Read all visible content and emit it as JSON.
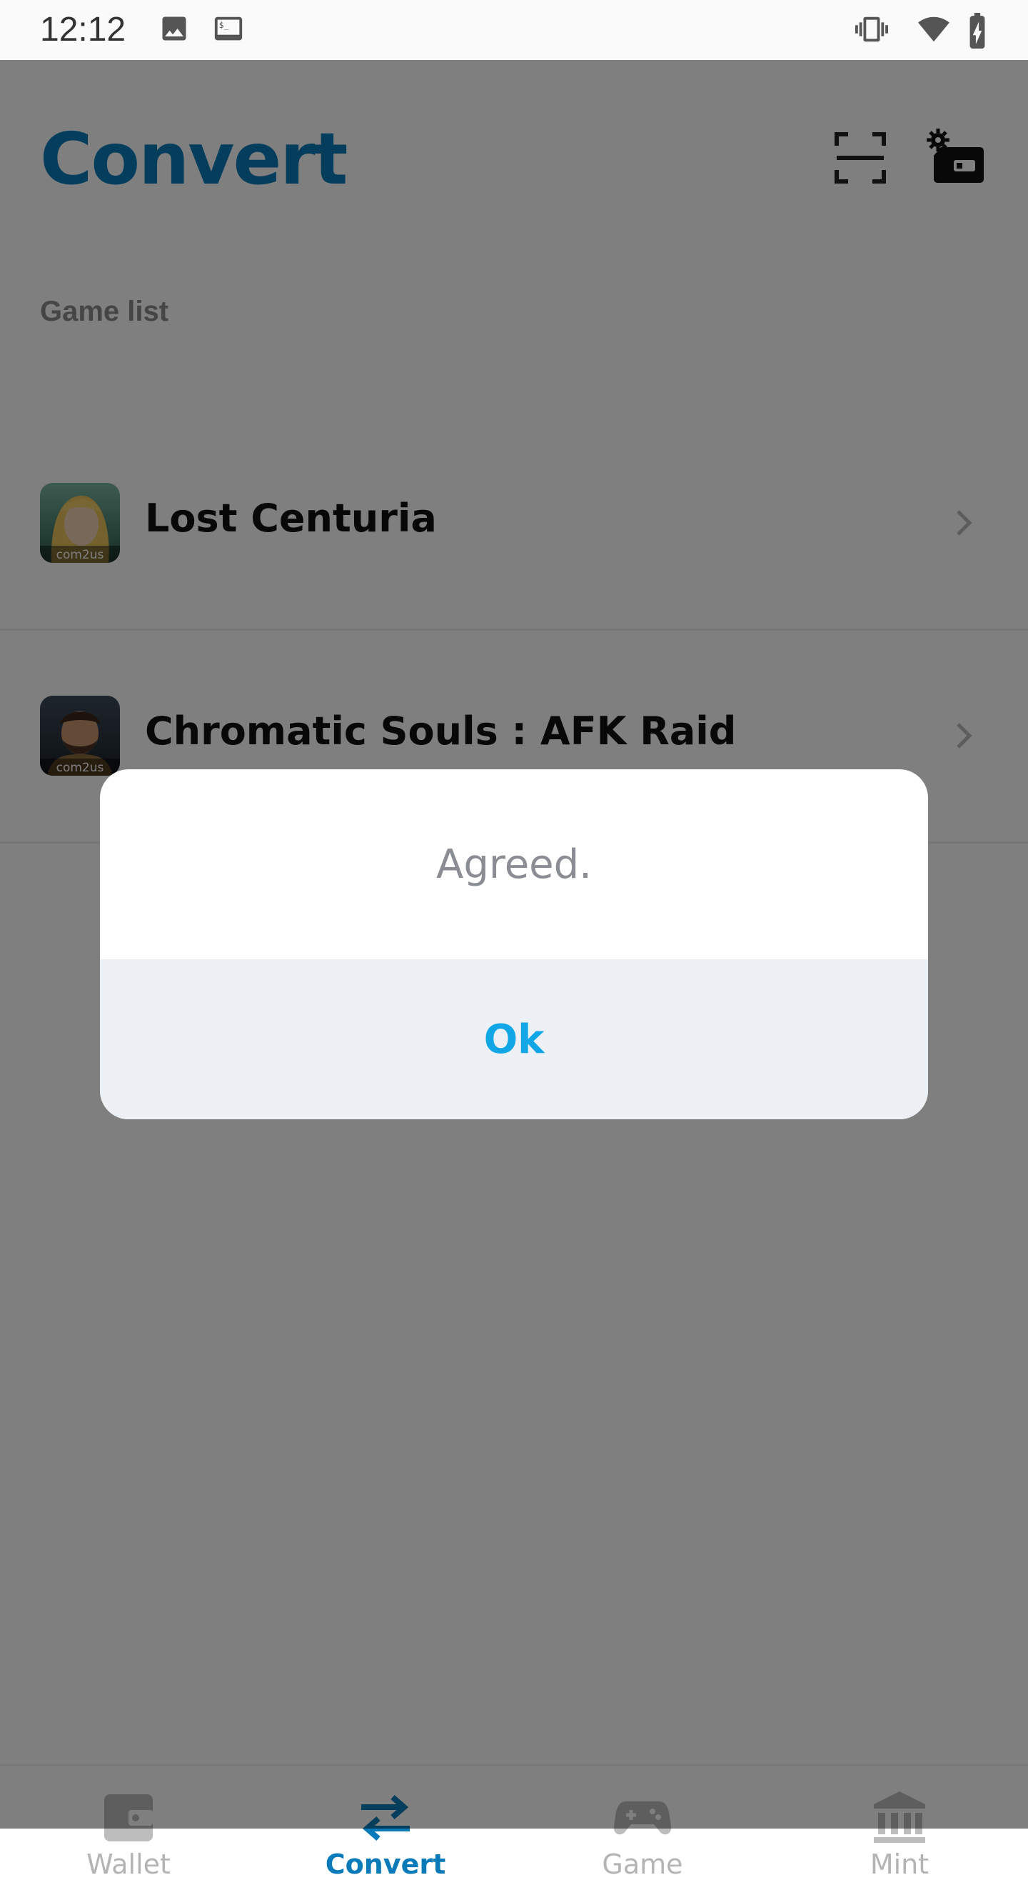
{
  "status_bar": {
    "time": "12:12",
    "icons": [
      "image-icon",
      "terminal-icon",
      "vibrate-icon",
      "wifi-icon",
      "battery-charging-icon"
    ]
  },
  "header": {
    "title": "Convert",
    "actions": [
      "scan-icon",
      "wallet-settings-icon"
    ]
  },
  "game_list": {
    "label": "Game list",
    "items": [
      {
        "name": "Lost Centuria",
        "publisher_badge": "com2us"
      },
      {
        "name": "Chromatic Souls : AFK Raid",
        "publisher_badge": "com2us"
      }
    ]
  },
  "dialog": {
    "message": "Agreed.",
    "ok_label": "Ok"
  },
  "bottom_nav": {
    "active": "Convert",
    "items": [
      {
        "label": "Wallet",
        "icon": "wallet-icon"
      },
      {
        "label": "Convert",
        "icon": "convert-arrows-icon"
      },
      {
        "label": "Game",
        "icon": "gamepad-icon"
      },
      {
        "label": "Mint",
        "icon": "bank-icon"
      }
    ]
  },
  "colors": {
    "accent": "#0a7ab8",
    "ok_button_text": "#11a6e6",
    "scrim": "rgba(0,0,0,0.5)",
    "dialog_footer_bg": "#edf0f5"
  }
}
